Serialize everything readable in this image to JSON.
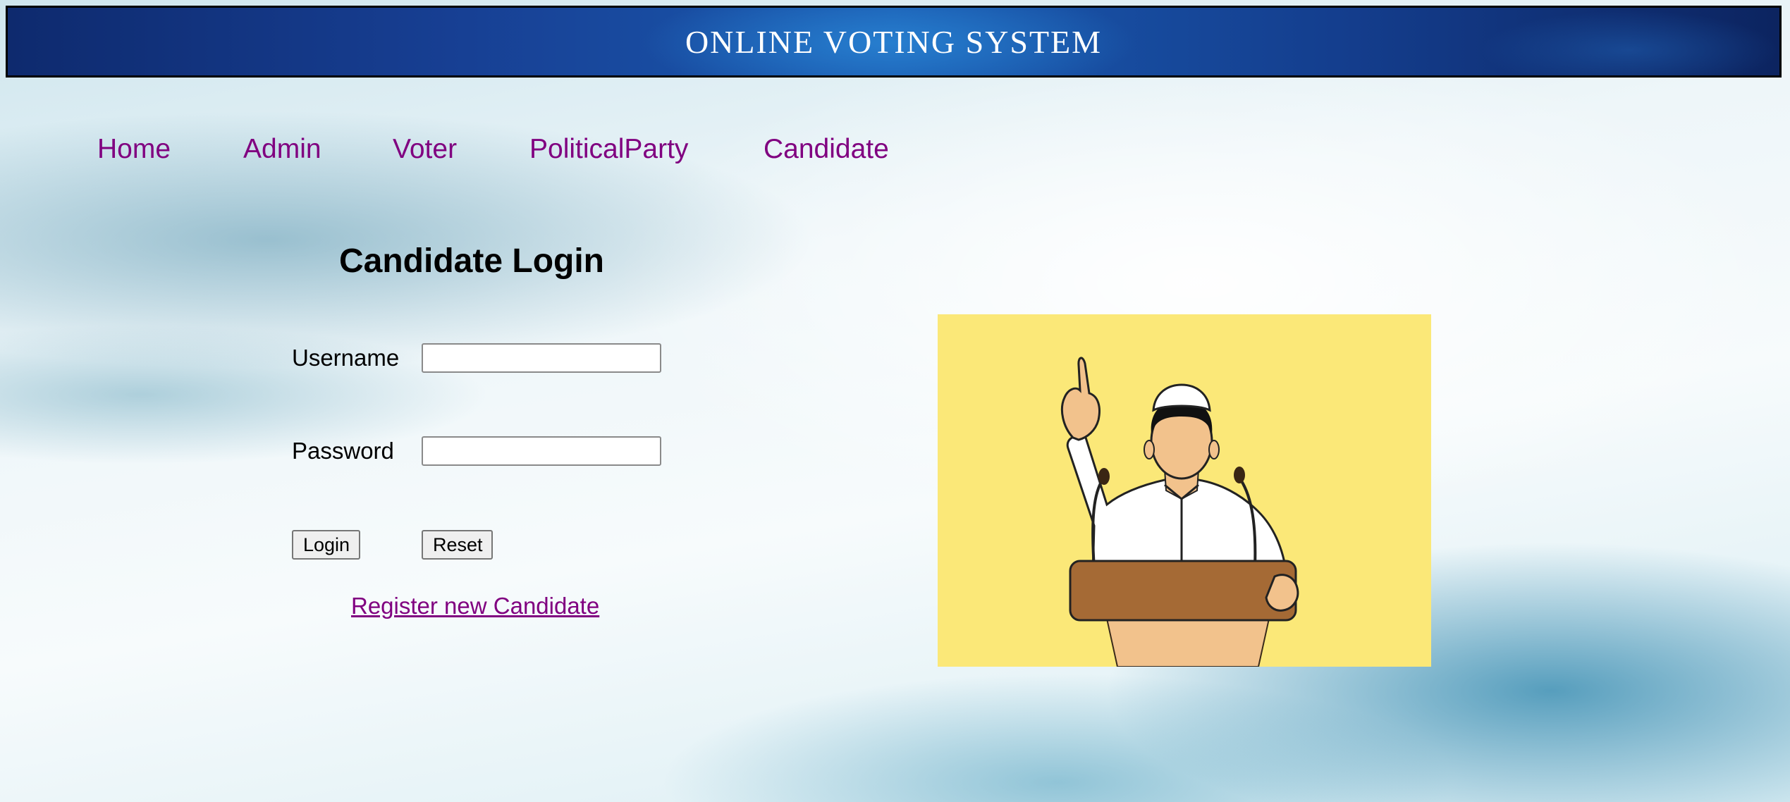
{
  "header": {
    "title": "ONLINE VOTING SYSTEM"
  },
  "nav": {
    "items": [
      {
        "label": "Home"
      },
      {
        "label": "Admin"
      },
      {
        "label": "Voter"
      },
      {
        "label": "PoliticalParty"
      },
      {
        "label": "Candidate"
      }
    ],
    "link_color": "#800080"
  },
  "login_form": {
    "heading": "Candidate Login",
    "username_label": "Username",
    "username_value": "",
    "password_label": "Password",
    "password_value": "",
    "login_button": "Login",
    "reset_button": "Reset",
    "register_link": "Register new Candidate"
  },
  "illustration": {
    "icon": "politician-at-podium-icon",
    "background_color": "#fbe878"
  }
}
